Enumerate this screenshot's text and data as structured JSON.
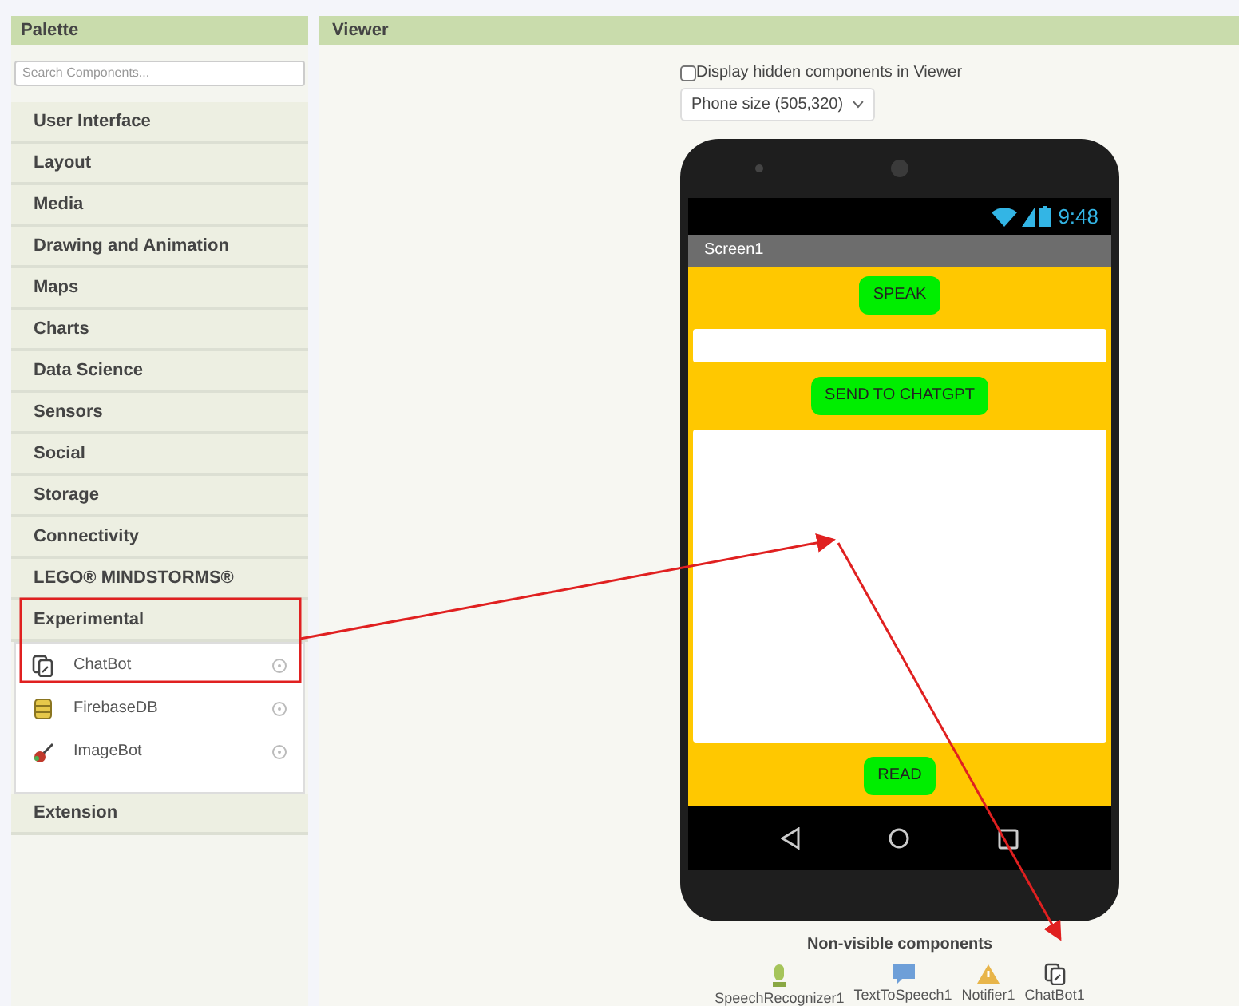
{
  "palette": {
    "title": "Palette",
    "search": {
      "placeholder": "Search Components..."
    },
    "categories": [
      {
        "label": "User Interface"
      },
      {
        "label": "Layout"
      },
      {
        "label": "Media"
      },
      {
        "label": "Drawing and Animation"
      },
      {
        "label": "Maps"
      },
      {
        "label": "Charts"
      },
      {
        "label": "Data Science"
      },
      {
        "label": "Sensors"
      },
      {
        "label": "Social"
      },
      {
        "label": "Storage"
      },
      {
        "label": "Connectivity"
      },
      {
        "label": "LEGO® MINDSTORMS®"
      },
      {
        "label": "Experimental",
        "children": [
          {
            "label": "ChatBot",
            "kind": "chatbot"
          },
          {
            "label": "FirebaseDB",
            "kind": "database"
          },
          {
            "label": "ImageBot",
            "kind": "imagebot"
          }
        ]
      },
      {
        "label": "Extension"
      }
    ]
  },
  "viewer": {
    "title": "Viewer",
    "hidden_toggle": {
      "label": "Display hidden components in Viewer",
      "checked": false
    },
    "size_select": {
      "value": "Phone size (505,320)"
    },
    "phone": {
      "time": "9:48",
      "screen_title": "Screen1",
      "components": [
        {
          "kind": "button",
          "label": "SPEAK"
        },
        {
          "kind": "textbox"
        },
        {
          "kind": "button",
          "label": "SEND TO CHATGPT"
        },
        {
          "kind": "textarea"
        },
        {
          "kind": "button",
          "label": "READ"
        }
      ]
    },
    "non_visible": {
      "title": "Non-visible components",
      "items": [
        {
          "label": "SpeechRecognizer1",
          "kind": "speech"
        },
        {
          "label": "TextToSpeech1",
          "kind": "tts"
        },
        {
          "label": "Notifier1",
          "kind": "notifier"
        },
        {
          "label": "ChatBot1",
          "kind": "chatbot"
        }
      ]
    }
  }
}
